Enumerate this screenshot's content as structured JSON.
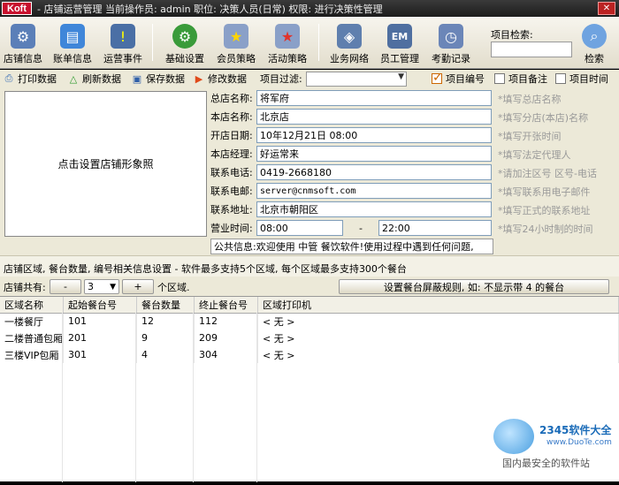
{
  "titlebar": {
    "logo": "Koft",
    "title": "- 店铺运营管理  当前操作员: admin 职位: 决策人员(日常) 权限: 进行决策性管理",
    "close": "✕"
  },
  "toolbar": {
    "items": [
      {
        "label": "店铺信息",
        "icon": "store-gear-icon"
      },
      {
        "label": "账单信息",
        "icon": "bill-icon"
      },
      {
        "label": "运营事件",
        "icon": "event-icon"
      },
      {
        "label": "基础设置",
        "icon": "settings-icon"
      },
      {
        "label": "会员策略",
        "icon": "member-star-icon"
      },
      {
        "label": "活动策略",
        "icon": "activity-star-icon"
      },
      {
        "label": "业务网络",
        "icon": "network-icon"
      },
      {
        "label": "员工管理",
        "icon": "employee-icon"
      },
      {
        "label": "考勤记录",
        "icon": "attendance-icon"
      },
      {
        "label": "检索",
        "icon": "search-icon"
      }
    ],
    "search_label": "项目检索:"
  },
  "actions": {
    "print": "打印数据",
    "refresh": "刷新数据",
    "save": "保存数据",
    "edit": "修改数据",
    "filter_label": "项目过滤:",
    "filter_value": "",
    "cb_code": "项目编号",
    "cb_note": "项目备注",
    "cb_time": "项目时间"
  },
  "store": {
    "photo_text": "点击设置店铺形象照",
    "fields": {
      "hq_label": "总店名称:",
      "hq": "将军府",
      "hq_hint": "*填写总店名称",
      "branch_label": "本店名称:",
      "branch": "北京店",
      "branch_hint": "*填写分店(本店)名称",
      "open_label": "开店日期:",
      "open": "10年12月21日 08:00",
      "open_hint": "*填写开张时间",
      "mgr_label": "本店经理:",
      "mgr": "好运常来",
      "mgr_hint": "*填写法定代理人",
      "phone_label": "联系电话:",
      "phone": "0419-2668180",
      "phone_hint": "*请加注区号 区号-电话",
      "email_label": "联系电邮:",
      "email": "server@cnmsoft.com",
      "email_hint": "*填写联系用电子邮件",
      "addr_label": "联系地址:",
      "addr": "北京市朝阳区",
      "addr_hint": "*填写正式的联系地址",
      "hours_label": "营业时间:",
      "open_time": "08:00",
      "close_time": "22:00",
      "hours_hint": "*填写24小时制的时间"
    },
    "notice": "公共信息:欢迎使用 中管 餐饮软件!使用过程中遇到任何问题,"
  },
  "area": {
    "info": "店铺区域, 餐台数量, 编号相关信息设置 - 软件最多支持5个区域, 每个区域最多支持300个餐台",
    "count_label": "店铺共有:",
    "minus": "-",
    "count": "3",
    "plus": "+",
    "unit": "个区域.",
    "rule_button": "设置餐台屏蔽规则, 如: 不显示带 4 的餐台"
  },
  "table": {
    "headers": [
      "区域名称",
      "起始餐台号",
      "餐台数量",
      "终止餐台号",
      "区域打印机"
    ],
    "rows": [
      [
        "一楼餐厅",
        "101",
        "12",
        "112",
        "< 无 >"
      ],
      [
        "二楼普通包厢",
        "201",
        "9",
        "209",
        "< 无 >"
      ],
      [
        "三楼VIP包厢",
        "301",
        "4",
        "304",
        "< 无 >"
      ]
    ]
  },
  "watermark": {
    "brand": "2345软件大全",
    "url": "www.DuoTe.com",
    "slogan": "国内最安全的软件站"
  }
}
